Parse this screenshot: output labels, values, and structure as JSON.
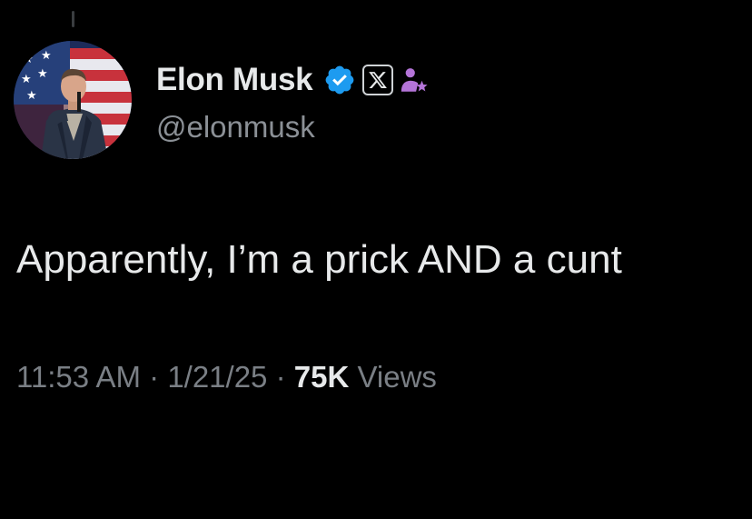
{
  "tweet": {
    "author": {
      "display_name": "Elon Musk",
      "handle": "@elonmusk",
      "avatar_icon": "profile-photo-flag-background",
      "verified_icon": "verified-badge-icon",
      "verified_color": "#1d9bf0",
      "affiliation_icon": "x-logo-icon",
      "role_icon": "person-star-icon",
      "role_icon_color": "#b474d8"
    },
    "text": "Apparently, I’m a prick AND a cunt",
    "timestamp": "11:53 AM",
    "date": "1/21/25",
    "separator": " · ",
    "views_count": "75K",
    "views_label": "Views"
  }
}
